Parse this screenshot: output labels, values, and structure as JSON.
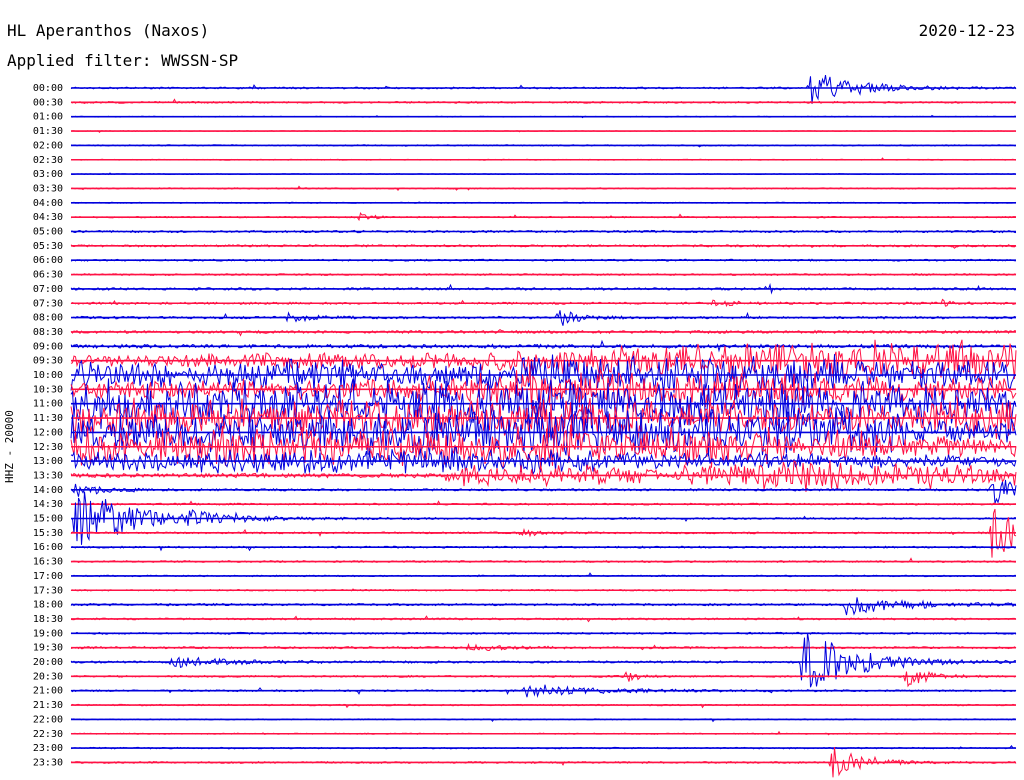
{
  "header": {
    "station": "HL Aperanthos (Naxos)",
    "date": "2020-12-23",
    "filter": "Applied filter: WWSSN-SP"
  },
  "chart_data": {
    "type": "line",
    "title": "HL Aperanthos (Naxos)",
    "subtitle": "Applied filter: WWSSN-SP",
    "date": "2020-12-23",
    "ylabel": "HHZ - 20000",
    "xlabel": "",
    "trace_interval_minutes": 30,
    "colors": {
      "even_trace": "#0000dd",
      "odd_trace": "#ff1144"
    },
    "grid": false,
    "legend": "none",
    "row_labels": [
      "00:00",
      "00:30",
      "01:00",
      "01:30",
      "02:00",
      "02:30",
      "03:00",
      "03:30",
      "04:00",
      "04:30",
      "05:00",
      "05:30",
      "06:00",
      "06:30",
      "07:00",
      "07:30",
      "08:00",
      "08:30",
      "09:00",
      "09:30",
      "10:00",
      "10:30",
      "11:00",
      "11:30",
      "12:00",
      "12:30",
      "13:00",
      "13:30",
      "14:00",
      "14:30",
      "15:00",
      "15:30",
      "16:00",
      "16:30",
      "17:00",
      "17:30",
      "18:00",
      "18:30",
      "19:00",
      "19:30",
      "20:00",
      "20:30",
      "21:00",
      "21:30",
      "22:00",
      "22:30",
      "23:00",
      "23:30"
    ],
    "noise_level": [
      1,
      1,
      0.5,
      0.4,
      0.7,
      0.5,
      0.5,
      0.7,
      0.6,
      0.8,
      1.2,
      1.2,
      1,
      1,
      1.3,
      1.2,
      1.3,
      1.5,
      2,
      3,
      3,
      3,
      3,
      3,
      3,
      3,
      2,
      1.5,
      1.2,
      1,
      1,
      1,
      1,
      1,
      0.8,
      0.8,
      1.2,
      1,
      1,
      1.2,
      1.2,
      1,
      1,
      0.8,
      0.6,
      0.6,
      0.8,
      1
    ],
    "band_amplitude": [
      0,
      0,
      0,
      0,
      0,
      0,
      0,
      0,
      0,
      0,
      0,
      0,
      0,
      0,
      0,
      0,
      0,
      0,
      0,
      [
        [
          0,
          3
        ],
        [
          0.42,
          8
        ],
        [
          0.65,
          16
        ],
        [
          0.8,
          20
        ],
        [
          0.96,
          20
        ],
        [
          1,
          18
        ]
      ],
      [
        [
          0,
          15
        ],
        [
          0.1,
          12
        ],
        [
          0.12,
          4
        ],
        [
          0.2,
          18
        ],
        [
          0.3,
          14
        ],
        [
          0.35,
          9
        ],
        [
          0.38,
          14
        ],
        [
          0.45,
          16
        ],
        [
          0.55,
          22
        ],
        [
          0.7,
          20
        ],
        [
          0.9,
          18
        ],
        [
          1,
          15
        ]
      ],
      [
        [
          0,
          8
        ],
        [
          0.3,
          8
        ],
        [
          0.4,
          14
        ],
        [
          0.5,
          20
        ],
        [
          0.6,
          18
        ],
        [
          0.8,
          16
        ],
        [
          0.9,
          10
        ],
        [
          1,
          12
        ]
      ],
      [
        [
          0,
          24
        ],
        [
          0.3,
          24
        ],
        [
          0.36,
          26
        ],
        [
          0.5,
          26
        ],
        [
          0.75,
          24
        ],
        [
          0.88,
          22
        ],
        [
          1,
          18
        ]
      ],
      [
        [
          0,
          18
        ],
        [
          0.4,
          20
        ],
        [
          0.58,
          22
        ],
        [
          0.7,
          16
        ],
        [
          0.88,
          12
        ],
        [
          0.92,
          20
        ],
        [
          1,
          22
        ]
      ],
      [
        [
          0,
          20
        ],
        [
          0.3,
          22
        ],
        [
          0.5,
          24
        ],
        [
          0.6,
          26
        ],
        [
          0.88,
          22
        ],
        [
          0.9,
          12
        ],
        [
          1,
          12
        ]
      ],
      [
        [
          0,
          22
        ],
        [
          0.3,
          20
        ],
        [
          0.45,
          20
        ],
        [
          0.5,
          24
        ],
        [
          0.6,
          20
        ],
        [
          0.8,
          18
        ],
        [
          0.9,
          12
        ],
        [
          1,
          10
        ]
      ],
      [
        [
          0,
          10
        ],
        [
          0.3,
          12
        ],
        [
          0.4,
          14
        ],
        [
          0.5,
          12
        ],
        [
          0.6,
          8
        ],
        [
          0.85,
          6
        ],
        [
          1,
          5
        ]
      ],
      [
        [
          0,
          1
        ],
        [
          0.39,
          1
        ],
        [
          0.41,
          12
        ],
        [
          0.6,
          10
        ],
        [
          0.63,
          3
        ],
        [
          0.66,
          14
        ],
        [
          0.73,
          18
        ],
        [
          0.78,
          20
        ],
        [
          0.85,
          16
        ],
        [
          0.9,
          14
        ],
        [
          1,
          10
        ]
      ],
      0,
      0,
      0,
      0,
      0,
      0,
      0,
      0,
      0,
      0,
      0,
      0,
      0,
      0,
      0,
      0,
      0,
      0,
      0,
      0
    ],
    "events": [
      {
        "row": 0,
        "x": 0.782,
        "amp": 18,
        "decay": 0.045
      },
      {
        "row": 9,
        "x": 0.306,
        "amp": 4,
        "decay": 0.012
      },
      {
        "row": 15,
        "x": 0.68,
        "amp": 5,
        "decay": 0.015
      },
      {
        "row": 15,
        "x": 0.92,
        "amp": 4,
        "decay": 0.01
      },
      {
        "row": 16,
        "x": 0.23,
        "amp": 4,
        "decay": 0.025
      },
      {
        "row": 16,
        "x": 0.516,
        "amp": 9,
        "decay": 0.018
      },
      {
        "row": 28,
        "x": 0.005,
        "amp": 10,
        "decay": 0.02
      },
      {
        "row": 28,
        "x": 0.975,
        "amp": 14,
        "decay": 0.03
      },
      {
        "row": 30,
        "x": 0.004,
        "amp": 32,
        "decay": 0.06
      },
      {
        "row": 30,
        "x": 0.125,
        "amp": 4,
        "decay": 0.04
      },
      {
        "row": 31,
        "x": 0.475,
        "amp": 4,
        "decay": 0.02
      },
      {
        "row": 31,
        "x": 0.975,
        "amp": 30,
        "decay": 0.03
      },
      {
        "row": 36,
        "x": 0.82,
        "amp": 10,
        "decay": 0.06
      },
      {
        "row": 39,
        "x": 0.42,
        "amp": 4,
        "decay": 0.03
      },
      {
        "row": 40,
        "x": 0.107,
        "amp": 6,
        "decay": 0.05
      },
      {
        "row": 40,
        "x": 0.773,
        "amp": 38,
        "decay": 0.05
      },
      {
        "row": 41,
        "x": 0.586,
        "amp": 7,
        "decay": 0.012
      },
      {
        "row": 41,
        "x": 0.884,
        "amp": 12,
        "decay": 0.02
      },
      {
        "row": 42,
        "x": 0.48,
        "amp": 6,
        "decay": 0.07
      },
      {
        "row": 47,
        "x": 0.805,
        "amp": 16,
        "decay": 0.03
      }
    ]
  }
}
